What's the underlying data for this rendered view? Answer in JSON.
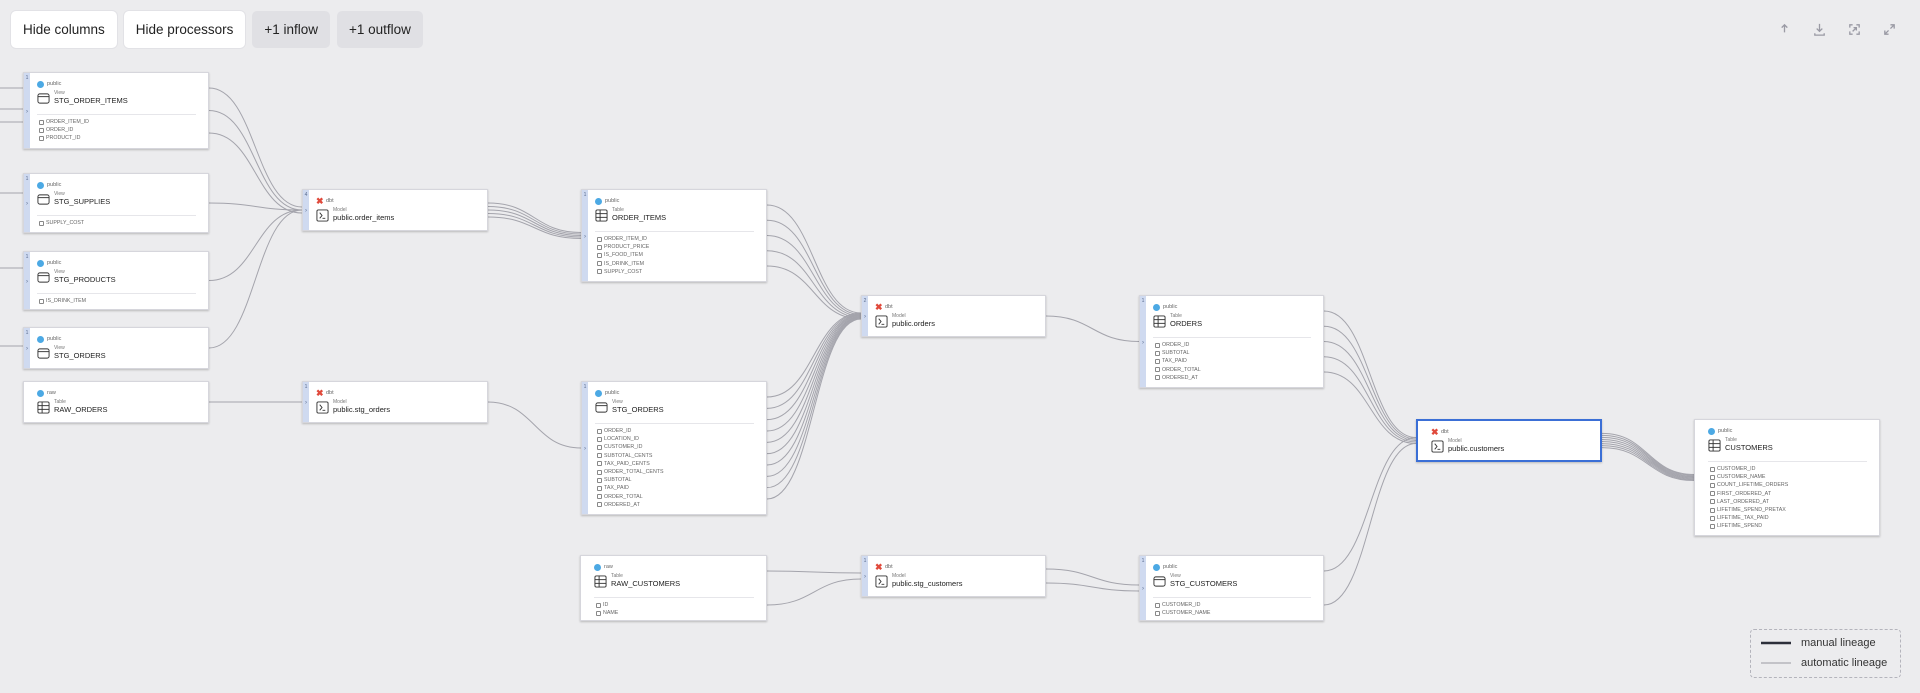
{
  "toolbar": {
    "hide_columns": "Hide columns",
    "hide_processors": "Hide processors",
    "inflow": "+1 inflow",
    "outflow": "+1 outflow"
  },
  "tools": [
    {
      "name": "share-icon"
    },
    {
      "name": "download-icon"
    },
    {
      "name": "fit-view-icon"
    },
    {
      "name": "fullscreen-icon"
    }
  ],
  "nodes": [
    {
      "id": "stg_order_items",
      "kind": "dataset",
      "namespace": "public",
      "type": "View",
      "name": "STG_ORDER_ITEMS",
      "rail": "1",
      "columns": [
        "ORDER_ITEM_ID",
        "ORDER_ID",
        "PRODUCT_ID"
      ]
    },
    {
      "id": "stg_supplies",
      "kind": "dataset",
      "namespace": "public",
      "type": "View",
      "name": "STG_SUPPLIES",
      "rail": "1",
      "columns": [
        "SUPPLY_COST"
      ]
    },
    {
      "id": "stg_products",
      "kind": "dataset",
      "namespace": "public",
      "type": "View",
      "name": "STG_PRODUCTS",
      "rail": "1",
      "columns": [
        "IS_DRINK_ITEM"
      ]
    },
    {
      "id": "stg_orders_top",
      "kind": "dataset",
      "namespace": "public",
      "type": "View",
      "name": "STG_ORDERS",
      "rail": "1",
      "columns": []
    },
    {
      "id": "raw_orders",
      "kind": "dataset",
      "namespace": "raw",
      "type": "Table",
      "name": "RAW_ORDERS",
      "rail": "",
      "columns": []
    },
    {
      "id": "proc_order_items",
      "kind": "processor",
      "namespace": "dbt",
      "type": "Model",
      "name": "public.order_items",
      "rail": "4",
      "columns": []
    },
    {
      "id": "proc_stg_orders",
      "kind": "processor",
      "namespace": "dbt",
      "type": "Model",
      "name": "public.stg_orders",
      "rail": "1",
      "columns": []
    },
    {
      "id": "order_items",
      "kind": "dataset",
      "namespace": "public",
      "type": "Table",
      "name": "ORDER_ITEMS",
      "rail": "1",
      "columns": [
        "ORDER_ITEM_ID",
        "PRODUCT_PRICE",
        "IS_FOOD_ITEM",
        "IS_DRINK_ITEM",
        "SUPPLY_COST"
      ]
    },
    {
      "id": "stg_orders",
      "kind": "dataset",
      "namespace": "public",
      "type": "View",
      "name": "STG_ORDERS",
      "rail": "1",
      "columns": [
        "ORDER_ID",
        "LOCATION_ID",
        "CUSTOMER_ID",
        "SUBTOTAL_CENTS",
        "TAX_PAID_CENTS",
        "ORDER_TOTAL_CENTS",
        "SUBTOTAL",
        "TAX_PAID",
        "ORDER_TOTAL",
        "ORDERED_AT"
      ]
    },
    {
      "id": "raw_customers",
      "kind": "dataset",
      "namespace": "raw",
      "type": "Table",
      "name": "RAW_CUSTOMERS",
      "rail": "",
      "columns": [
        "ID",
        "NAME"
      ]
    },
    {
      "id": "proc_orders",
      "kind": "processor",
      "namespace": "dbt",
      "type": "Model",
      "name": "public.orders",
      "rail": "2",
      "columns": []
    },
    {
      "id": "proc_stg_customers",
      "kind": "processor",
      "namespace": "dbt",
      "type": "Model",
      "name": "public.stg_customers",
      "rail": "1",
      "columns": []
    },
    {
      "id": "orders",
      "kind": "dataset",
      "namespace": "public",
      "type": "Table",
      "name": "ORDERS",
      "rail": "1",
      "columns": [
        "ORDER_ID",
        "SUBTOTAL",
        "TAX_PAID",
        "ORDER_TOTAL",
        "ORDERED_AT"
      ]
    },
    {
      "id": "stg_customers",
      "kind": "dataset",
      "namespace": "public",
      "type": "View",
      "name": "STG_CUSTOMERS",
      "rail": "1",
      "columns": [
        "CUSTOMER_ID",
        "CUSTOMER_NAME"
      ]
    },
    {
      "id": "proc_customers",
      "kind": "processor",
      "namespace": "dbt",
      "type": "Model",
      "name": "public.customers",
      "rail": "",
      "selected": true,
      "columns": []
    },
    {
      "id": "customers",
      "kind": "dataset",
      "namespace": "public",
      "type": "Table",
      "name": "CUSTOMERS",
      "rail": "",
      "columns": [
        "CUSTOMER_ID",
        "CUSTOMER_NAME",
        "COUNT_LIFETIME_ORDERS",
        "FIRST_ORDERED_AT",
        "LAST_ORDERED_AT",
        "LIFETIME_SPEND_PRETAX",
        "LIFETIME_TAX_PAID",
        "LIFETIME_SPEND"
      ]
    }
  ],
  "legend": {
    "manual": "manual lineage",
    "automatic": "automatic lineage"
  },
  "colors": {
    "background": "#ececee",
    "accent": "#3b6fd6",
    "rail": "#cfdaf0",
    "dbt": "#e0493b",
    "database": "#4ca9e4",
    "edge": "#a4a4ac"
  }
}
